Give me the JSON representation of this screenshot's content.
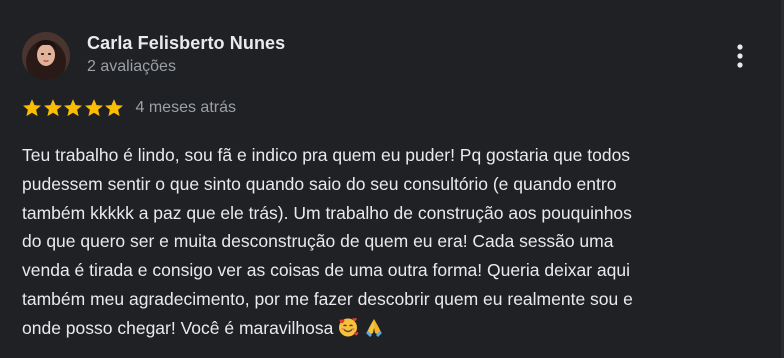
{
  "review": {
    "author_name": "Carla Felisberto Nunes",
    "author_meta": "2 avaliações",
    "rating": 5,
    "rating_max": 5,
    "date": "4 meses atrás",
    "text_lines": [
      "Teu trabalho é lindo, sou fã e indico pra quem eu puder! Pq gostaria que todos",
      "pudessem sentir o que sinto quando saio do seu consultório (e quando entro",
      "também kkkkk a paz que ele trás). Um trabalho de construção aos pouquinhos",
      "do que quero ser e muita desconstrução de quem eu era! Cada sessão uma",
      "venda é tirada e consigo ver as coisas de uma outra forma! Queria deixar aqui",
      "também meu agradecimento, por me fazer descobrir quem eu realmente sou e",
      "onde posso chegar! Você é maravilhosa"
    ],
    "emojis": [
      "smiling-face-with-hearts",
      "folded-hands"
    ]
  },
  "colors": {
    "background": "#202124",
    "primary_text": "#e8eaed",
    "secondary_text": "#9aa0a6",
    "star": "#fbbc04"
  },
  "icons": {
    "menu": "more-vert-icon",
    "star": "star-icon"
  }
}
